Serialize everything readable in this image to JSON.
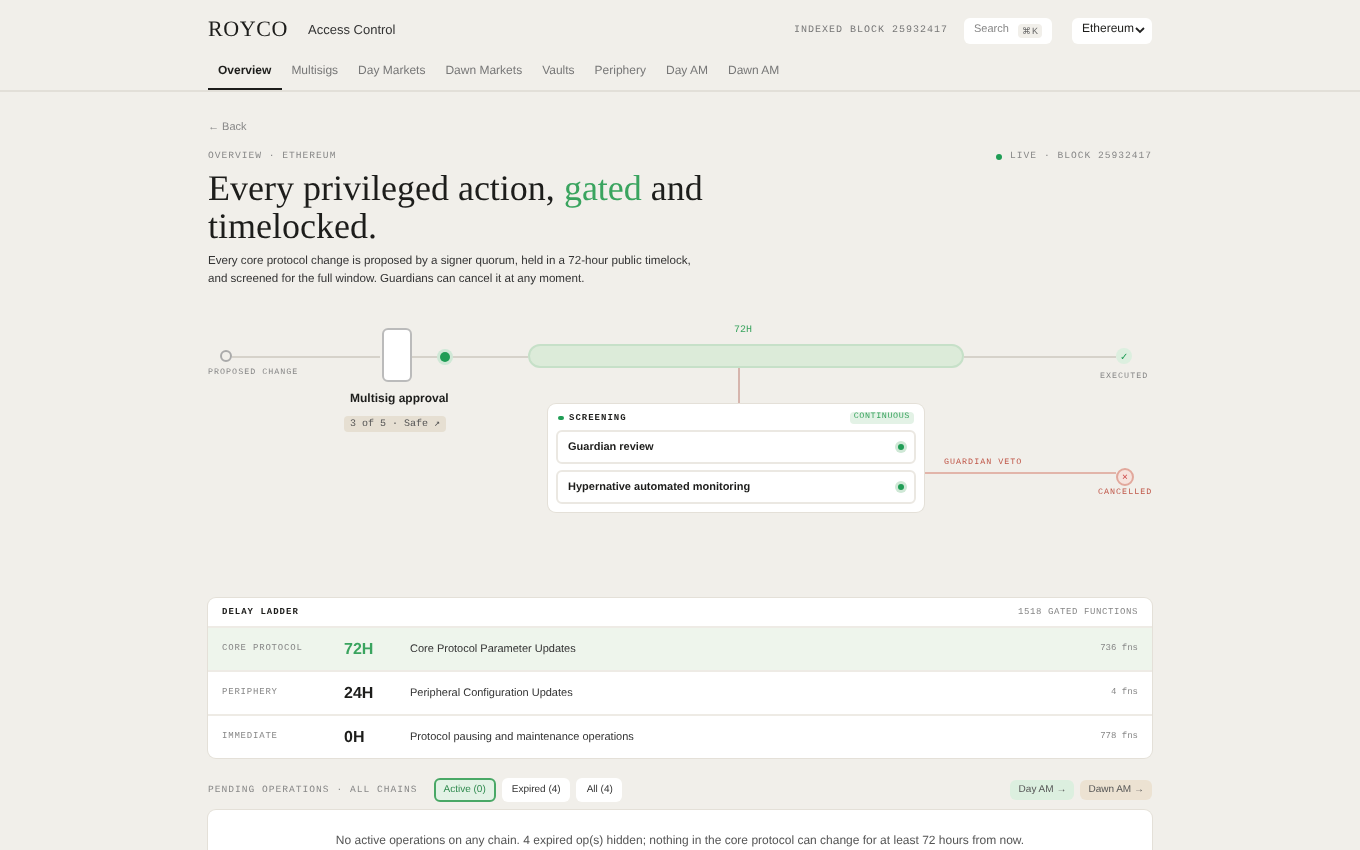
{
  "header": {
    "logo": "ROYCO",
    "title": "Access Control",
    "indexed_block": "INDEXED BLOCK 25932417",
    "search": {
      "placeholder": "Search",
      "shortcut": "⌘K"
    },
    "network": "Ethereum"
  },
  "tabs": [
    {
      "label": "Overview",
      "selected": true
    },
    {
      "label": "Multisigs",
      "selected": false
    },
    {
      "label": "Day Markets",
      "selected": false
    },
    {
      "label": "Dawn Markets",
      "selected": false
    },
    {
      "label": "Vaults",
      "selected": false
    },
    {
      "label": "Periphery",
      "selected": false
    },
    {
      "label": "Day AM",
      "selected": false
    },
    {
      "label": "Dawn AM",
      "selected": false
    }
  ],
  "back": "← Back",
  "breadcrumb": "OVERVIEW · ETHEREUM",
  "live_status": "LIVE · BLOCK 25932417",
  "headline": "Every privileged action, **gated** and timelocked.",
  "description": "Every core protocol change is proposed by a signer quorum, held in a 72-hour public timelock, and screened for the full window. Guardians can cancel it at any moment.",
  "timeline": {
    "start_label": "PROPOSED CHANGE",
    "approval_title": "Multisig approval",
    "approval_badge": "3 of 5 · Safe ↗",
    "duration": "72H",
    "end_label": "EXECUTED",
    "end_mark": "✓",
    "veto_label": "GUARDIAN VETO",
    "cancel_mark": "×",
    "cancel_label": "CANCELLED",
    "screening": {
      "title": "SCREENING",
      "badge": "CONTINUOUS",
      "items": [
        "Guardian review",
        "Hypernative automated monitoring"
      ]
    }
  },
  "delay_ladder": {
    "title": "DELAY LADDER",
    "count": "1518 GATED FUNCTIONS",
    "rows": [
      {
        "tier": "CORE PROTOCOL",
        "delay": "72H",
        "description": "Core Protocol Parameter Updates",
        "functions": "736 fns",
        "selected": true
      },
      {
        "tier": "PERIPHERY",
        "delay": "24H",
        "description": "Peripheral Configuration Updates",
        "functions": "4 fns",
        "selected": false
      },
      {
        "tier": "IMMEDIATE",
        "delay": "0H",
        "description": "Protocol pausing and maintenance operations",
        "functions": "778 fns",
        "selected": false
      }
    ]
  },
  "pending": {
    "title": "PENDING OPERATIONS · ALL CHAINS",
    "filters": [
      {
        "label": "Active (0)",
        "selected": true
      },
      {
        "label": "Expired (4)",
        "selected": false
      },
      {
        "label": "All (4)",
        "selected": false
      }
    ],
    "chains": [
      {
        "label": "Day AM →",
        "color": "#dcefdf"
      },
      {
        "label": "Dawn AM →",
        "color": "#ece2d2"
      }
    ],
    "empty_message": "No active operations on any chain. 4 expired op(s) hidden; nothing in the core protocol can change for at least 72 hours from now."
  }
}
